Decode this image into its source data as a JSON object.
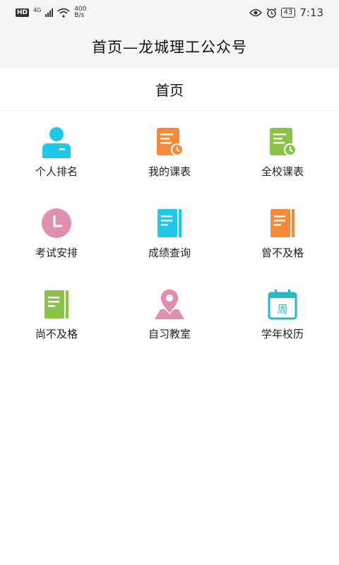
{
  "status_bar": {
    "hd": "HD",
    "signal_type": "4G",
    "net_speed_value": "400",
    "net_speed_unit": "B/s",
    "battery": "43",
    "time": "7:13"
  },
  "app_header": {
    "title": "首页—龙城理工公众号"
  },
  "page": {
    "title": "首页"
  },
  "menu": {
    "items": [
      {
        "label": "个人排名",
        "icon": "person-icon",
        "color": "#1ec8e6"
      },
      {
        "label": "我的课表",
        "icon": "schedule-clock-icon",
        "color": "#f7893b"
      },
      {
        "label": "全校课表",
        "icon": "schedule-clock-icon",
        "color": "#8bc34a"
      },
      {
        "label": "考试安排",
        "icon": "clock-icon",
        "color": "#e08fb0"
      },
      {
        "label": "成绩查询",
        "icon": "notebook-icon",
        "color": "#1ec8e6"
      },
      {
        "label": "曾不及格",
        "icon": "notebook-icon",
        "color": "#f7893b"
      },
      {
        "label": "尚不及格",
        "icon": "notebook-icon",
        "color": "#8bc34a"
      },
      {
        "label": "自习教室",
        "icon": "map-pin-icon",
        "color": "#e08fb0"
      },
      {
        "label": "学年校历",
        "icon": "calendar-icon",
        "color": "#29b6c8"
      }
    ],
    "calendar_glyph": "周"
  }
}
